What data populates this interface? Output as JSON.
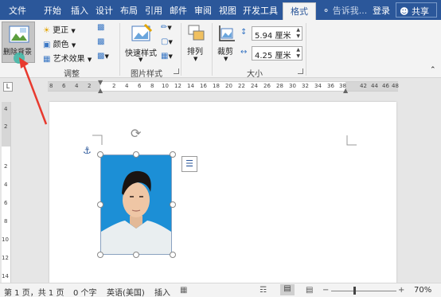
{
  "tabs": [
    "文件",
    "开始",
    "插入",
    "设计",
    "布局",
    "引用",
    "邮件",
    "审阅",
    "视图",
    "开发工具",
    "格式"
  ],
  "tell_me": "告诉我...",
  "login": "登录",
  "share": "共享",
  "ribbon": {
    "remove_bg": "删除背景",
    "correct": "更正",
    "color": "颜色",
    "artistic": "艺术效果",
    "adjust_group": "调整",
    "quick_styles": "快速样式",
    "picture_styles_group": "图片样式",
    "arrange": "排列",
    "crop": "裁剪",
    "height_value": "5.94 厘米",
    "width_value": "4.25 厘米",
    "size_group": "大小"
  },
  "ruler": {
    "h_left": [
      "8",
      "6",
      "4",
      "2"
    ],
    "h_mid": [
      "2",
      "4",
      "6",
      "8",
      "10",
      "12",
      "14",
      "16",
      "18",
      "20",
      "22",
      "24",
      "26",
      "28",
      "30",
      "32",
      "34",
      "36",
      "38"
    ],
    "h_right": [
      "42",
      "44",
      "46",
      "48"
    ],
    "v": [
      "4",
      "2",
      "2",
      "4",
      "6",
      "8",
      "10",
      "12",
      "14"
    ],
    "corner": "L"
  },
  "status": {
    "page": "第 1 页，共 1 页",
    "words": "0 个字",
    "lang": "英语(美国)",
    "mode": "插入",
    "zoom": "70%",
    "zoom_level_pct": 70
  },
  "colors": {
    "titlebar": "#2b579a",
    "photo_bg": "#1c8fd6",
    "arrow": "#e83a2f"
  }
}
